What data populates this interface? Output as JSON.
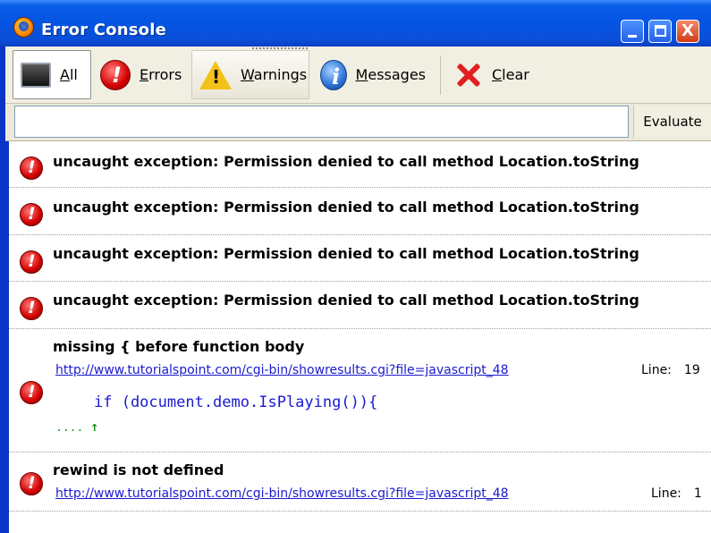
{
  "window": {
    "title": "Error Console",
    "controls": {
      "minimize": "minimize",
      "maximize": "maximize",
      "close": "X"
    }
  },
  "toolbar": {
    "all_prefix": "A",
    "all_rest": "ll",
    "errors_prefix": "E",
    "errors_rest": "rrors",
    "warnings_prefix": "W",
    "warnings_rest": "arnings",
    "messages_prefix": "M",
    "messages_rest": "essages",
    "clear_prefix": "C",
    "clear_rest": "lear",
    "active": "All"
  },
  "evaluate": {
    "input_value": "",
    "button_label": "Evaluate"
  },
  "entries": [
    {
      "message": "uncaught exception: Permission denied to call method Location.toString"
    },
    {
      "message": "uncaught exception: Permission denied to call method Location.toString"
    },
    {
      "message": "uncaught exception: Permission denied to call method Location.toString"
    },
    {
      "message": "uncaught exception: Permission denied to call method Location.toString"
    },
    {
      "message": "missing { before function body",
      "source": "http://www.tutorialspoint.com/cgi-bin/showresults.cgi?file=javascript_48",
      "line_label": "Line:",
      "line_number": "19",
      "code": "if (document.demo.IsPlaying()){",
      "caret_dots": "....",
      "caret_arrow": "↑"
    },
    {
      "message": "rewind is not defined",
      "source": "http://www.tutorialspoint.com/cgi-bin/showresults.cgi?file=javascript_48",
      "line_label": "Line:",
      "line_number": "1"
    }
  ],
  "colors": {
    "titlebar": "#0554e3",
    "link": "#1a1ad0",
    "error_icon": "#d10000",
    "caret": "#1e9a1e"
  },
  "icons": {
    "title": "firefox-logo-icon",
    "all": "console-icon",
    "errors": "error-icon",
    "warnings": "warning-icon",
    "messages": "info-icon",
    "clear": "clear-x-icon"
  }
}
